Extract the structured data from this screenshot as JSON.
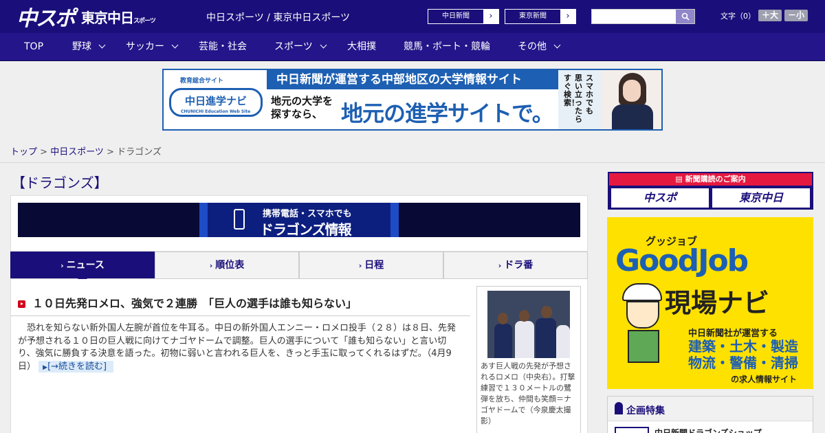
{
  "header": {
    "logo_chuspo": "中スポ",
    "logo_tokyo": "東京中日",
    "logo_tokyo_small": "スポーツ",
    "sites": "中日スポーツ / 東京中日スポーツ",
    "btn_chunichi": "中日新聞",
    "btn_tokyo": "東京新聞",
    "search_placeholder": "",
    "font_label": "文字（0）",
    "font_big": "＋大",
    "font_small": "－小",
    "colors": {
      "header": "#1a0f7a",
      "nav": "#24158a",
      "accent_red": "#e51940"
    }
  },
  "nav": {
    "items": [
      {
        "label": "TOP",
        "dropdown": false
      },
      {
        "label": "野球",
        "dropdown": true
      },
      {
        "label": "サッカー",
        "dropdown": true
      },
      {
        "label": "芸能・社会",
        "dropdown": false
      },
      {
        "label": "スポーツ",
        "dropdown": true
      },
      {
        "label": "大相撲",
        "dropdown": false
      },
      {
        "label": "競馬・ボート・競輪",
        "dropdown": false
      },
      {
        "label": "その他",
        "dropdown": true
      }
    ]
  },
  "ad_banner": {
    "top_label": "教育総合サイト",
    "logo": "中日進学ナビ",
    "logo_sub": "CHUNICHI Education Web Site",
    "headline": "中日新聞が運営する中部地区の大学情報サイト",
    "line2": "地元の大学を\n探すなら、",
    "big": "地元の進学サイトで。",
    "vertical": [
      "スマホでも",
      "思い立ったら",
      "すぐ検索！"
    ]
  },
  "breadcrumb": {
    "home": "トップ",
    "section": "中日スポーツ",
    "current": "ドラゴンズ",
    "sep": " > "
  },
  "page_title": "【ドラゴンズ】",
  "dragons_banner": {
    "line1": "携帯電話・スマホでも",
    "line2": "ドラゴンズ情報"
  },
  "tabs": [
    {
      "label": "ニュース",
      "active": true
    },
    {
      "label": "順位表",
      "active": false
    },
    {
      "label": "日程",
      "active": false
    },
    {
      "label": "ドラ番",
      "active": false
    }
  ],
  "article": {
    "title": "１０日先発ロメロ、強気で２連勝　「巨人の選手は誰も知らない」",
    "body": "恐れを知らない新外国人左腕が首位を牛耳る。中日の新外国人エンニー・ロメロ投手（２８）は８日、先発が予想される１０日の巨人戦に向けてナゴヤドームで調整。巨人の選手について「誰も知らない」と言い切り、強気に勝負する決意を語った。初物に弱いと言われる巨人を、きっと手玉に取ってくれるはずだ。",
    "date": "（4月9日）",
    "more": "[→続きを読む]",
    "caption": "あす巨人戦の先発が予想されるロメロ（中央右）。打撃練習で１３０メートルの鷺弾を放ち、仲間も笑顔＝ナゴヤドームで（今泉慶太撮影）"
  },
  "aside": {
    "subscribe_header": "新聞購読のご案内",
    "subscribe_left": "中スポ",
    "subscribe_right": "東京中日",
    "goodjob_kana": "グッジョブ",
    "goodjob_word": "GoodJob",
    "goodjob_navi": "現場ナビ",
    "goodjob_line1": "中日新聞社が運営する",
    "goodjob_line2a": "建築・土木・製造",
    "goodjob_line2b": "物流・警備・清掃",
    "goodjob_line3": "の求人情報サイト",
    "kikaku_title": "企画特集",
    "kikaku_item": "中日新聞ドラゴンズショップ"
  }
}
